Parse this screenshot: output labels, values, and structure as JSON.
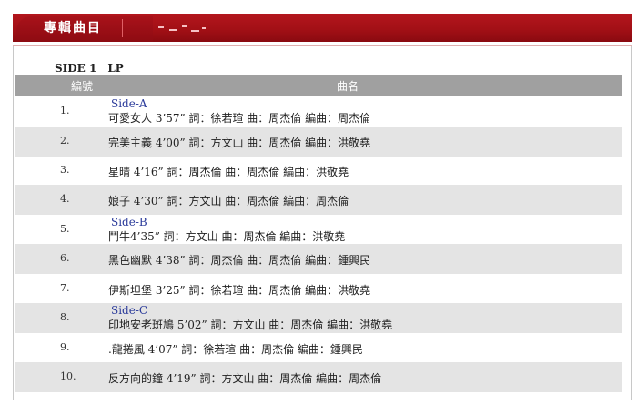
{
  "section": {
    "title": "專輯曲目",
    "side_label": "SIDE 1　LP"
  },
  "table": {
    "headers": {
      "number": "編號",
      "title": "曲名"
    },
    "rows": [
      {
        "num": "1.",
        "side": "Side-A",
        "text": "可愛女人 3’57” 詞：徐若瑄 曲：周杰倫 編曲：周杰倫"
      },
      {
        "num": "2.",
        "side": "",
        "text": "完美主義 4’00” 詞：方文山 曲：周杰倫 編曲：洪敬堯"
      },
      {
        "num": "3.",
        "side": "",
        "text": "星晴 4’16” 詞：周杰倫 曲：周杰倫 編曲：洪敬堯"
      },
      {
        "num": "4.",
        "side": "",
        "text": "娘子 4’30” 詞：方文山 曲：周杰倫 編曲：周杰倫"
      },
      {
        "num": "5.",
        "side": "Side-B",
        "text": "鬥牛4’35” 詞：方文山 曲：周杰倫 編曲：洪敬堯"
      },
      {
        "num": "6.",
        "side": "",
        "text": "黑色幽默 4’38” 詞：周杰倫 曲：周杰倫 編曲：鍾興民"
      },
      {
        "num": "7.",
        "side": "",
        "text": "伊斯坦堡 3’25” 詞：徐若瑄 曲：周杰倫 編曲：洪敬堯"
      },
      {
        "num": "8.",
        "side": "Side-C",
        "text": "印地安老斑鳩 5’02” 詞：方文山 曲：周杰倫 編曲：洪敬堯"
      },
      {
        "num": "9.",
        "side": "",
        "text": ".龍捲風 4’07” 詞：徐若瑄 曲：周杰倫 編曲：鍾興民"
      },
      {
        "num": "10.",
        "side": "",
        "text": "反方向的鐘 4’19” 詞：方文山 曲：周杰倫 編曲：周杰倫"
      }
    ]
  },
  "colors": {
    "header_red": "#a31016",
    "table_head_gray": "#a0a0a0",
    "alt_row_gray": "#e4e4e4",
    "side_label_blue": "#2a3a9a"
  }
}
